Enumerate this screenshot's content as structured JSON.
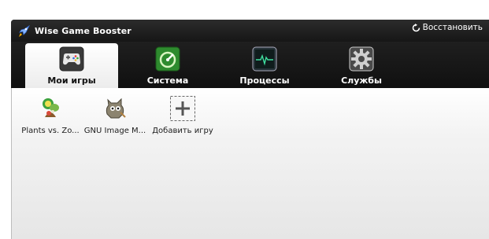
{
  "window": {
    "title": "Wise Game Booster",
    "restore_label": "Восстановить"
  },
  "tabs": [
    {
      "label": "Мои игры",
      "icon": "gamepad-icon",
      "active": true
    },
    {
      "label": "Система",
      "icon": "speedometer-icon",
      "active": false
    },
    {
      "label": "Процессы",
      "icon": "pulse-monitor-icon",
      "active": false
    },
    {
      "label": "Службы",
      "icon": "gear-icon",
      "active": false
    }
  ],
  "games": [
    {
      "label": "Plants vs. Zo...",
      "icon": "plants-vs-zombies-icon"
    },
    {
      "label": "GNU Image M...",
      "icon": "gimp-icon"
    },
    {
      "label": "Добавить игру",
      "icon": "add-game-icon"
    }
  ],
  "colors": {
    "titlebar": "#1b1b1b",
    "tab_active_bg": "#ffffff",
    "system_icon": "#2e8b2e",
    "content_bg": "#e6e6e6"
  }
}
